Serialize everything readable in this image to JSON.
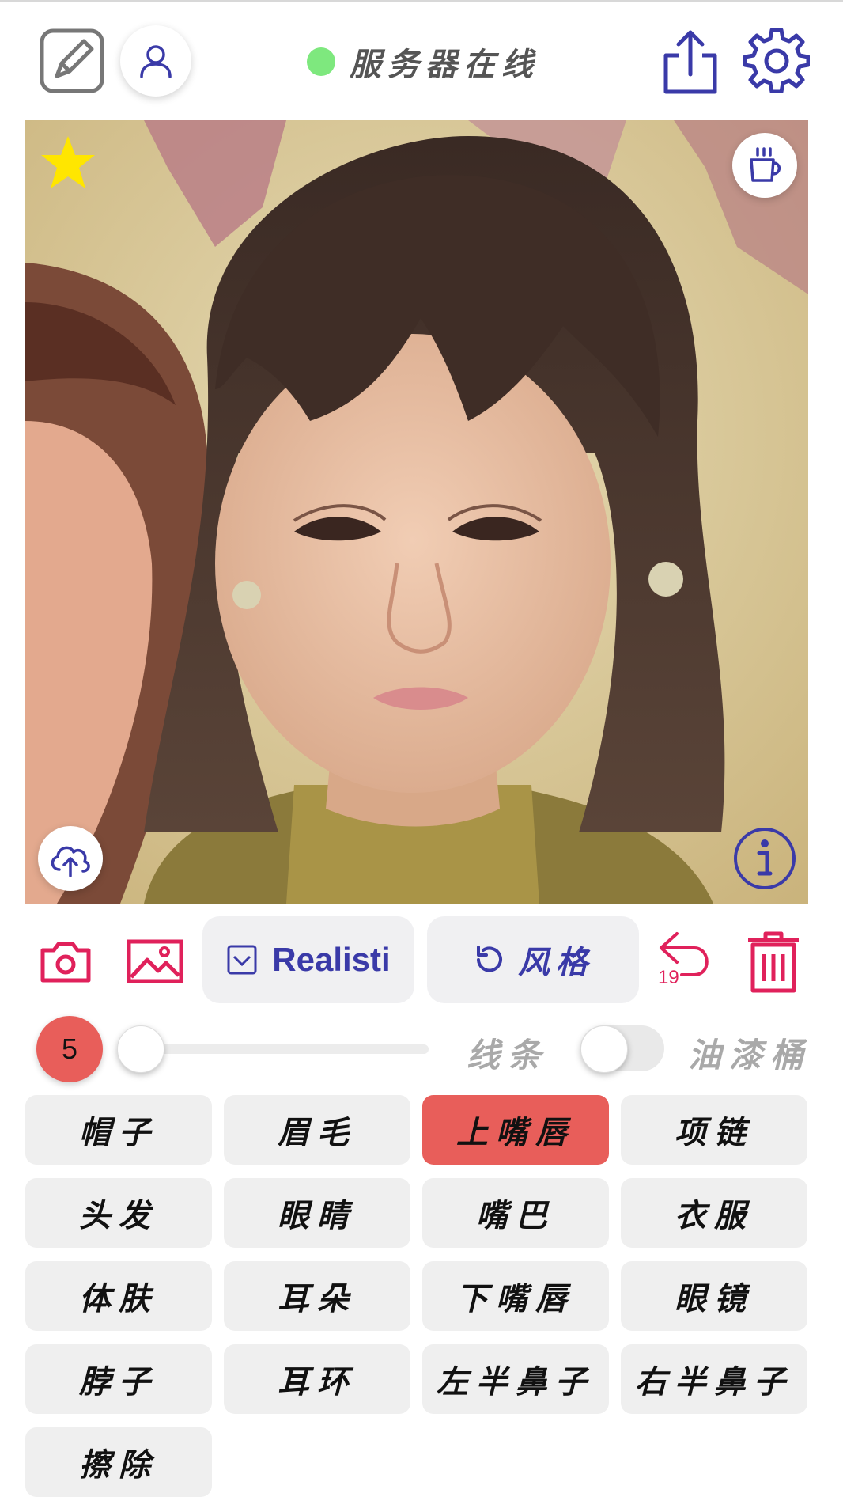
{
  "header": {
    "status_text": "服务器在线",
    "status_color": "#7ee87e",
    "icons": [
      "edit-icon",
      "user-icon",
      "share-icon",
      "settings-icon"
    ]
  },
  "photo": {
    "overlay_icons": [
      "star-icon",
      "coffee-icon",
      "upload-cloud-icon",
      "info-icon"
    ]
  },
  "toolbar": {
    "realistic_label": "Realisti",
    "style_label": "风格",
    "undo_count": "19",
    "icons": [
      "camera-icon",
      "image-icon",
      "checkbox-icon",
      "refresh-icon",
      "undo-icon",
      "trash-icon"
    ]
  },
  "brush": {
    "size": "5",
    "line_label": "线条",
    "bucket_label": "油漆桶",
    "size_value_fraction": 0.0,
    "bucket_switch_on": false
  },
  "parts": [
    {
      "label": "帽子",
      "selected": false
    },
    {
      "label": "眉毛",
      "selected": false
    },
    {
      "label": "上嘴唇",
      "selected": true
    },
    {
      "label": "项链",
      "selected": false
    },
    {
      "label": "头发",
      "selected": false
    },
    {
      "label": "眼睛",
      "selected": false
    },
    {
      "label": "嘴巴",
      "selected": false
    },
    {
      "label": "衣服",
      "selected": false
    },
    {
      "label": "体肤",
      "selected": false
    },
    {
      "label": "耳朵",
      "selected": false
    },
    {
      "label": "下嘴唇",
      "selected": false
    },
    {
      "label": "眼镜",
      "selected": false
    },
    {
      "label": "脖子",
      "selected": false
    },
    {
      "label": "耳环",
      "selected": false
    },
    {
      "label": "左半鼻子",
      "selected": false
    },
    {
      "label": "右半鼻子",
      "selected": false
    },
    {
      "label": "擦除",
      "selected": false
    }
  ],
  "colors": {
    "accent_red": "#e85e5a",
    "icon_pink": "#e0215b",
    "icon_blue": "#3a3aa8"
  }
}
